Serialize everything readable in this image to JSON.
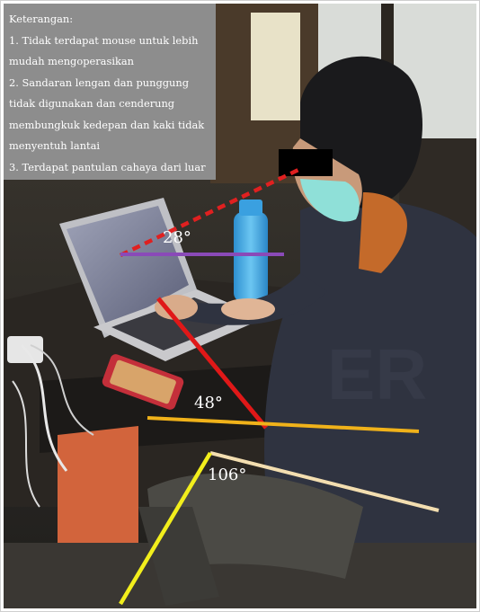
{
  "caption": {
    "title": "Keterangan:",
    "lines": [
      "1. Tidak terdapat mouse untuk lebih",
      "mudah mengoperasikan",
      "2. Sandaran lengan dan punggung",
      "tidak digunakan dan cenderung",
      "membungkuk kedepan dan kaki tidak",
      "menyentuh lantai",
      "3. Terdapat pantulan cahaya dari luar"
    ]
  },
  "angles": {
    "neck": "28°",
    "trunk": "48°",
    "knee": "106°"
  },
  "colors": {
    "neck_line": "#e02020",
    "horizontal_line": "#8a4ab8",
    "trunk_line": "#e01818",
    "hip_line": "#f0b21a",
    "thigh_line": "#f3deb0",
    "shin_line": "#f2ee1c",
    "caption_bg": "#8d8d8d"
  }
}
